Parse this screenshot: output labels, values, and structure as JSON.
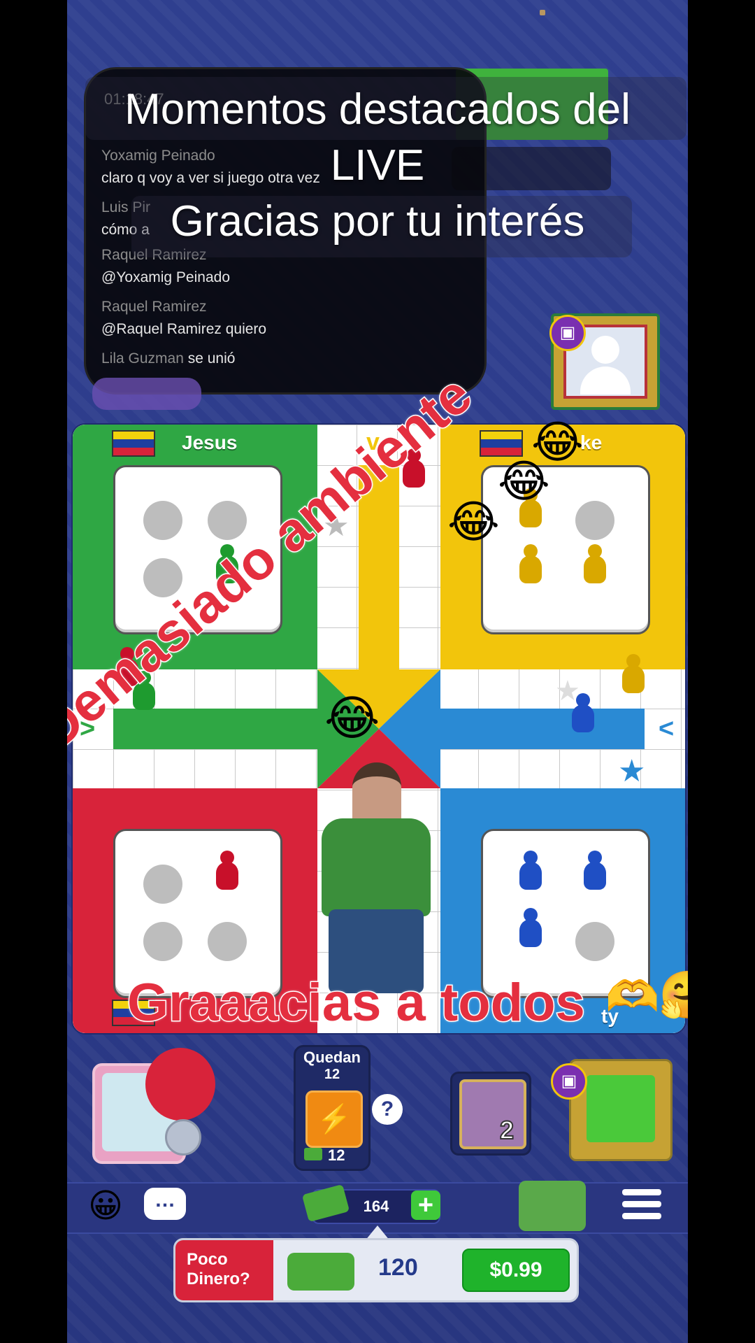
{
  "chat": {
    "partial_top": "01:18:47",
    "messages": [
      {
        "name": "Yoxamig Peinado",
        "text": "claro q voy a ver si juego otra vez"
      },
      {
        "name": "Luis Pir",
        "text": "cómo a"
      },
      {
        "name": "Raquel Ramirez",
        "text": "@Yoxamig Peinado"
      },
      {
        "name": "Raquel Ramirez",
        "text": "@Raquel Ramirez quiero"
      },
      {
        "name": "Lila Guzman",
        "text": "se unió"
      }
    ]
  },
  "title_overlay": {
    "line1": "Momentos destacados del",
    "line2": "LIVE",
    "line3": "Gracias por tu interés"
  },
  "players": {
    "green": {
      "name": "Jesus"
    },
    "yellow": {
      "name": "ke"
    },
    "red": {
      "name": ""
    },
    "blue": {
      "name": "ty"
    }
  },
  "overlay_texts": {
    "diagonal": "Demasiado ambiente",
    "bottom": "Graaacias a todos"
  },
  "emojis": {
    "laugh": "😂",
    "hands_heart": "🫶",
    "hug": "🤗"
  },
  "bottom_ui": {
    "quedan_label": "Quedan",
    "quedan_count": "12",
    "energy_cost": "12",
    "help_icon": "?",
    "card_level": "2",
    "money": "164",
    "promo": {
      "label_line1": "Poco",
      "label_line2": "Dinero?",
      "amount": "120",
      "price": "$0.99"
    }
  },
  "colors": {
    "green": "#2fa744",
    "yellow": "#f2c50c",
    "red": "#d8233a",
    "blue": "#2a8ad4",
    "background": "#2d3c8b"
  }
}
